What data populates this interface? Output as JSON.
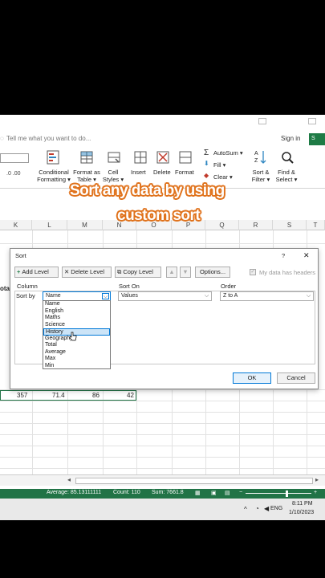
{
  "ribbon": {
    "tell_me": "Tell me what you want to do...",
    "sign_in": "Sign in",
    "share": "S",
    "conditional_formatting": [
      "Conditional",
      "Formatting ▾"
    ],
    "format_as_table": [
      "Format as",
      "Table ▾"
    ],
    "cell_styles": [
      "Cell",
      "Styles ▾"
    ],
    "insert": "Insert",
    "delete": "Delete",
    "format": "Format",
    "autosum": "AutoSum ▾",
    "fill": "Fill ▾",
    "clear": "Clear ▾",
    "sort_filter": [
      "Sort &",
      "Filter ▾"
    ],
    "find_select": [
      "Find &",
      "Select ▾"
    ]
  },
  "caption": {
    "line1": "Sort any data by using",
    "line2": "custom sort"
  },
  "grid": {
    "partial_label": "ota",
    "columns": [
      "K",
      "L",
      "M",
      "N",
      "O",
      "P",
      "Q",
      "R",
      "S",
      "T"
    ],
    "row_values": [
      "357",
      "71.4",
      "86",
      "42"
    ]
  },
  "dialog": {
    "title": "Sort",
    "help": "?",
    "close": "✕",
    "add_level": "Add Level",
    "delete_level": "Delete Level",
    "copy_level": "Copy Level",
    "options": "Options...",
    "my_data_headers": "My data has headers",
    "col_header": "Column",
    "sorton_header": "Sort On",
    "order_header": "Order",
    "sort_by": "Sort by",
    "column_value": "Name",
    "sorton_value": "Values",
    "order_value": "Z to A",
    "options_list": [
      "Name",
      "English",
      "Maths",
      "Science",
      "History",
      "Geography",
      "Total",
      "Average",
      "Max",
      "Min"
    ],
    "selected_index": 4,
    "ok": "OK",
    "cancel": "Cancel"
  },
  "status": {
    "average": "Average: 85.13111111",
    "count": "Count: 110",
    "sum": "Sum: 7661.8"
  },
  "taskbar": {
    "lang": "ENG",
    "time": "8:11 PM",
    "date": "1/10/2023"
  }
}
